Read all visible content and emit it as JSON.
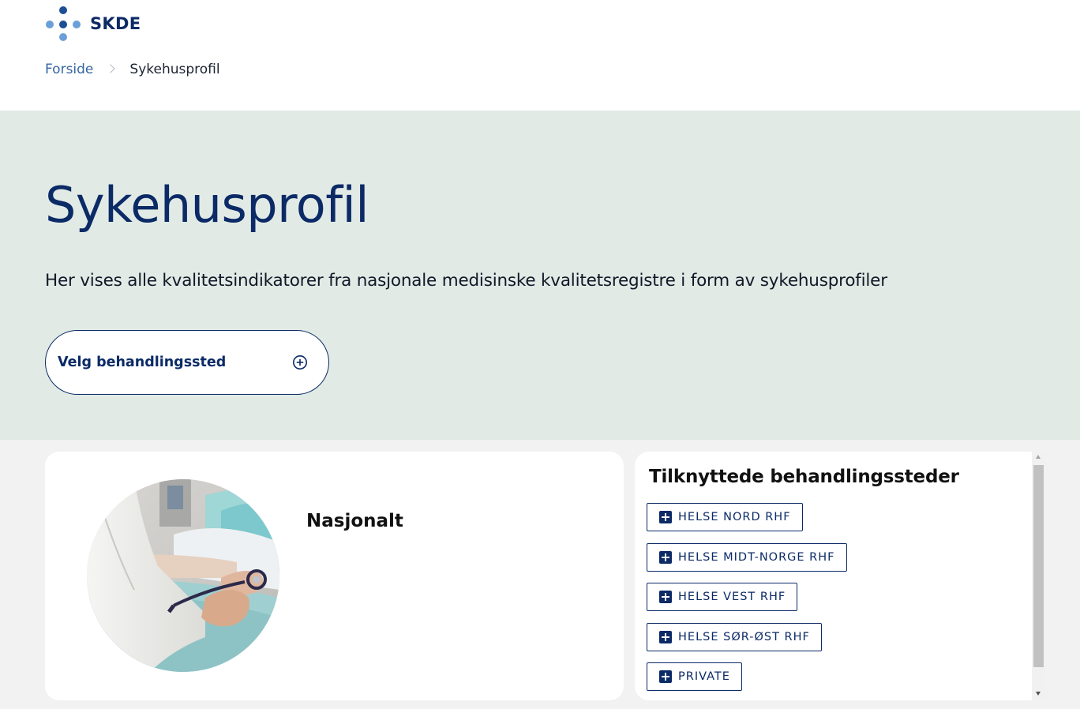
{
  "brand": {
    "name": "SKDE",
    "logo_colors": [
      "#6a9fd8",
      "#1c4e94"
    ]
  },
  "breadcrumb": {
    "home": "Forside",
    "current": "Sykehusprofil"
  },
  "hero": {
    "title": "Sykehusprofil",
    "description": "Her vises alle kvalitetsindikatorer fra nasjonale medisinske kvalitetsregistre i form av sykehusprofiler",
    "select_label": "Velg behandlingssted",
    "select_icon": "plus-circle-icon"
  },
  "profile": {
    "name": "Nasjonalt",
    "image": "doctor-patient-photo"
  },
  "units": {
    "title": "Tilknyttede behandlingssteder",
    "icon": "plus-square-icon",
    "items": [
      {
        "label": "HELSE NORD RHF"
      },
      {
        "label": "HELSE MIDT-NORGE RHF"
      },
      {
        "label": "HELSE VEST RHF"
      },
      {
        "label": "HELSE SØR-ØST RHF"
      },
      {
        "label": "PRIVATE"
      }
    ]
  },
  "colors": {
    "navy": "#0b2a66",
    "hero_bg": "#e1eae5",
    "link": "#3566a0",
    "page_bg": "#f2f2f2"
  }
}
